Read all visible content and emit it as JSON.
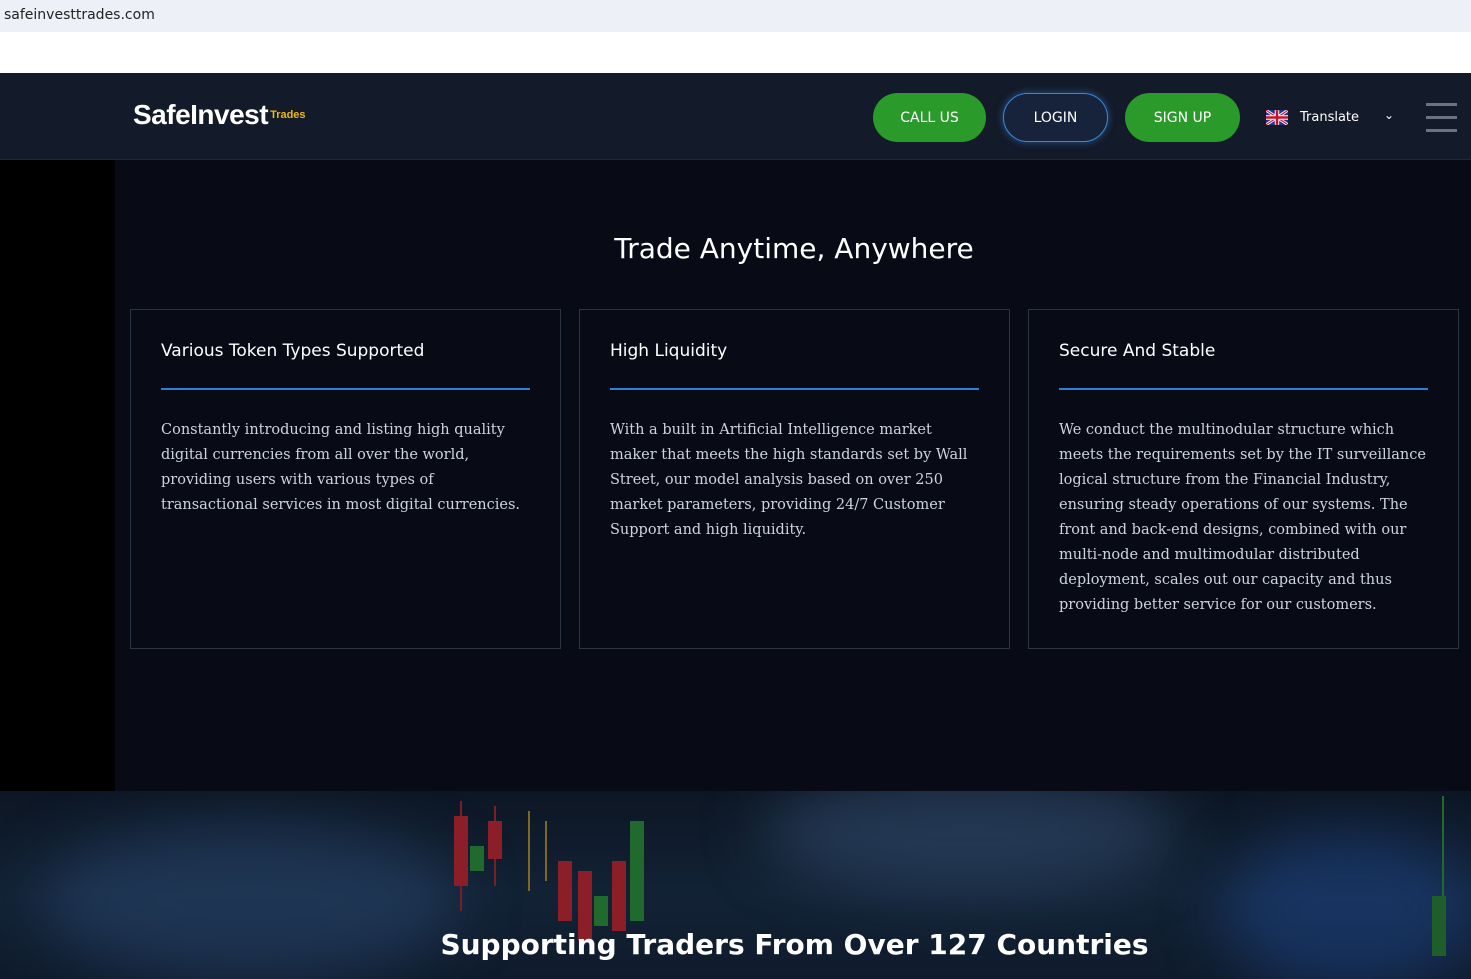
{
  "browser": {
    "url": "safeinvesttrades.com"
  },
  "header": {
    "logo_main": "SafeInvest",
    "logo_sub": "Trades",
    "call_label": "CALL US",
    "login_label": "LOGIN",
    "signup_label": "SIGN UP",
    "translate_label": "Translate",
    "menu_icon": "hamburger-icon"
  },
  "colors": {
    "nav_bg": "#131a29",
    "page_bg": "#080b16",
    "green_button": "#2a9a2a",
    "accent_line": "#2f7fd6",
    "logo_accent": "#f0b90b"
  },
  "main": {
    "title": "Trade Anytime, Anywhere",
    "cards": [
      {
        "title": "Various Token Types Supported",
        "text": "Constantly introducing and listing high quality digital currencies from all over the world, providing users with various types of transactional services in most digital currencies."
      },
      {
        "title": "High Liquidity",
        "text": "With a built in Artificial Intelligence market maker that meets the high standards set by Wall Street, our model analysis based on over 250 market parameters, providing 24/7 Customer Support and high liquidity."
      },
      {
        "title": "Secure And Stable",
        "text": "We conduct the multinodular structure which meets the requirements set by the IT surveillance logical structure from the Financial Industry, ensuring steady operations of our systems. The front and back-end designs, combined with our multi-node and multimodular distributed deployment, scales out our capacity and thus providing better service for our customers."
      }
    ]
  },
  "bottom": {
    "title": "Supporting Traders From Over 127 Countries"
  }
}
